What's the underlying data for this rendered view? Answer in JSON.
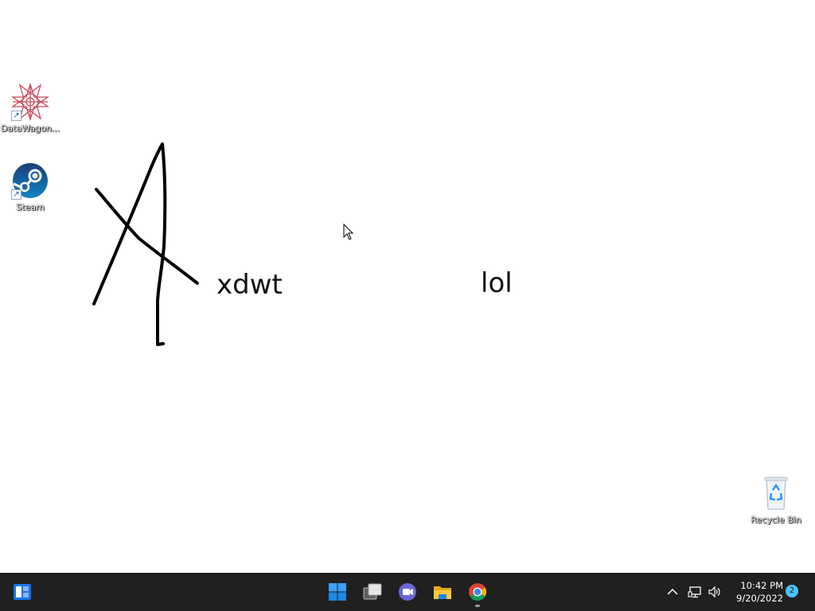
{
  "theme": {
    "wallpaper": "#ffffff",
    "taskbar": "#202020",
    "accent": "#4cc2ff"
  },
  "desktop": {
    "icons": [
      {
        "label": "DataWagon...",
        "icon": "datawagon-icon"
      },
      {
        "label": "Steam",
        "icon": "steam-icon"
      },
      {
        "label": "Recycle Bin",
        "icon": "recycle-bin-icon"
      }
    ],
    "canvas": {
      "texts": [
        "xdwt",
        "lol"
      ],
      "drawing": "handwritten-a-drawing"
    }
  },
  "taskbar": {
    "apps": [
      {
        "icon": "widgets-icon"
      },
      {
        "icon": "start-windows-icon"
      },
      {
        "icon": "task-view-icon"
      },
      {
        "icon": "teams-chat-icon"
      },
      {
        "icon": "file-explorer-icon"
      },
      {
        "icon": "chrome-icon",
        "running": true
      }
    ],
    "tray": {
      "icons": [
        "chevron-up-icon",
        "network-icon",
        "volume-icon"
      ],
      "time": "10:42 PM",
      "date": "9/20/2022",
      "notification_count": "2"
    }
  }
}
